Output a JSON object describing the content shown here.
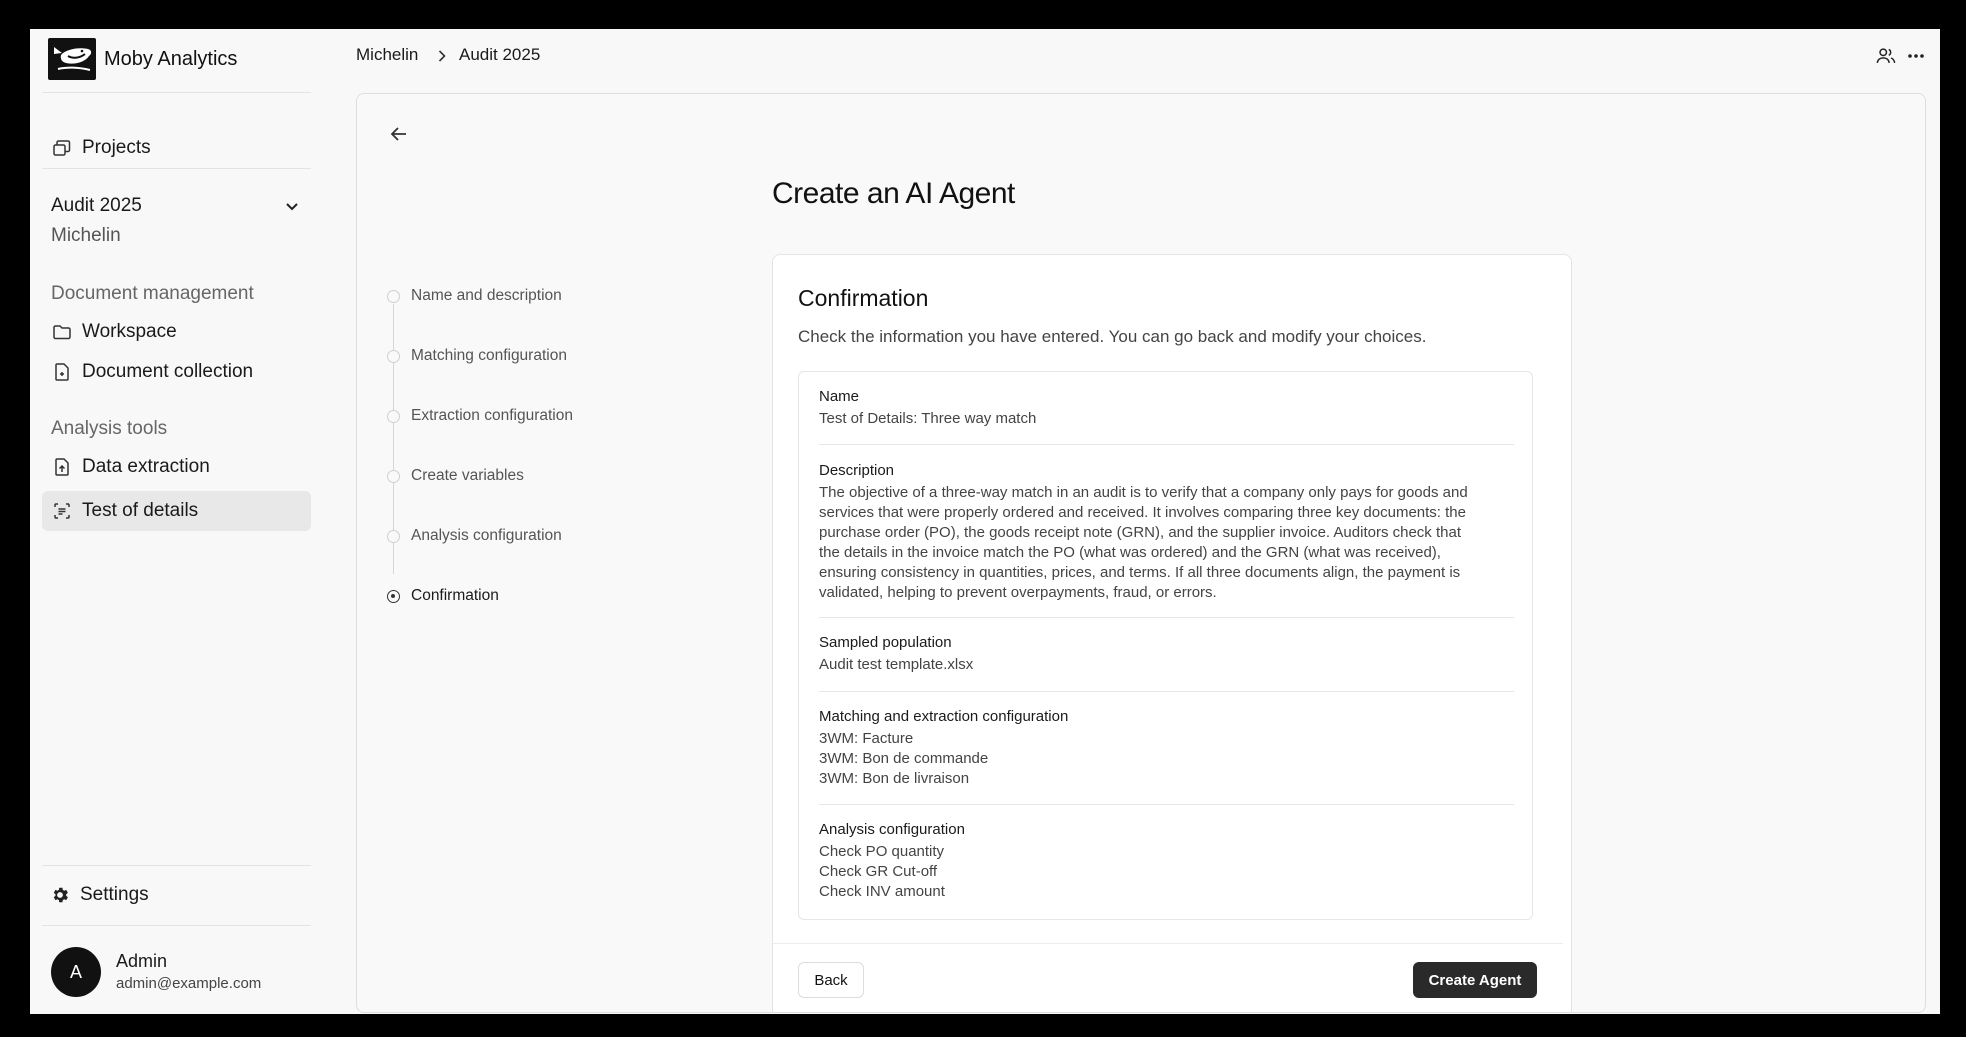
{
  "brand": {
    "name": "Moby Analytics"
  },
  "sidebar": {
    "projects_label": "Projects",
    "project": {
      "name": "Audit 2025",
      "client": "Michelin"
    },
    "sections": [
      {
        "label": "Document management",
        "items": [
          {
            "label": "Workspace",
            "icon": "folder-icon"
          },
          {
            "label": "Document collection",
            "icon": "document-collection-icon"
          }
        ]
      },
      {
        "label": "Analysis tools",
        "items": [
          {
            "label": "Data extraction",
            "icon": "data-extraction-icon"
          },
          {
            "label": "Test of details",
            "icon": "test-of-details-icon",
            "active": true
          }
        ]
      }
    ],
    "settings_label": "Settings",
    "user": {
      "initial": "A",
      "name": "Admin",
      "email": "admin@example.com"
    }
  },
  "breadcrumb": {
    "items": [
      "Michelin",
      "Audit 2025"
    ]
  },
  "page": {
    "title": "Create an AI Agent"
  },
  "stepper": {
    "steps": [
      {
        "label": "Name and description"
      },
      {
        "label": "Matching configuration"
      },
      {
        "label": "Extraction configuration"
      },
      {
        "label": "Create variables"
      },
      {
        "label": "Analysis configuration"
      },
      {
        "label": "Confirmation",
        "current": true
      }
    ]
  },
  "confirmation": {
    "title": "Confirmation",
    "subtitle": "Check the information you have entered. You can go back and modify your choices.",
    "fields": {
      "name": {
        "label": "Name",
        "value": "Test of Details: Three way match"
      },
      "description": {
        "label": "Description",
        "lines": [
          "The objective of a three-way match in an audit is to verify that a company only pays for goods and",
          "services that were properly ordered and received. It involves comparing three key documents: the",
          "purchase order (PO), the goods receipt note (GRN), and the supplier invoice. Auditors check that",
          "the details in the invoice match the PO (what was ordered) and the GRN (what was received),",
          "ensuring consistency in quantities, prices, and terms. If all three documents align, the payment is",
          "validated, helping to prevent overpayments, fraud, or errors."
        ]
      },
      "sampled_population": {
        "label": "Sampled population",
        "value": "Audit test template.xlsx"
      },
      "matching": {
        "label": "Matching and extraction configuration",
        "lines": [
          "3WM: Facture",
          "3WM: Bon de commande",
          "3WM: Bon de livraison"
        ]
      },
      "analysis": {
        "label": "Analysis configuration",
        "lines": [
          "Check PO quantity",
          "Check GR Cut-off",
          "Check INV amount"
        ]
      }
    },
    "back_label": "Back",
    "create_label": "Create Agent"
  }
}
